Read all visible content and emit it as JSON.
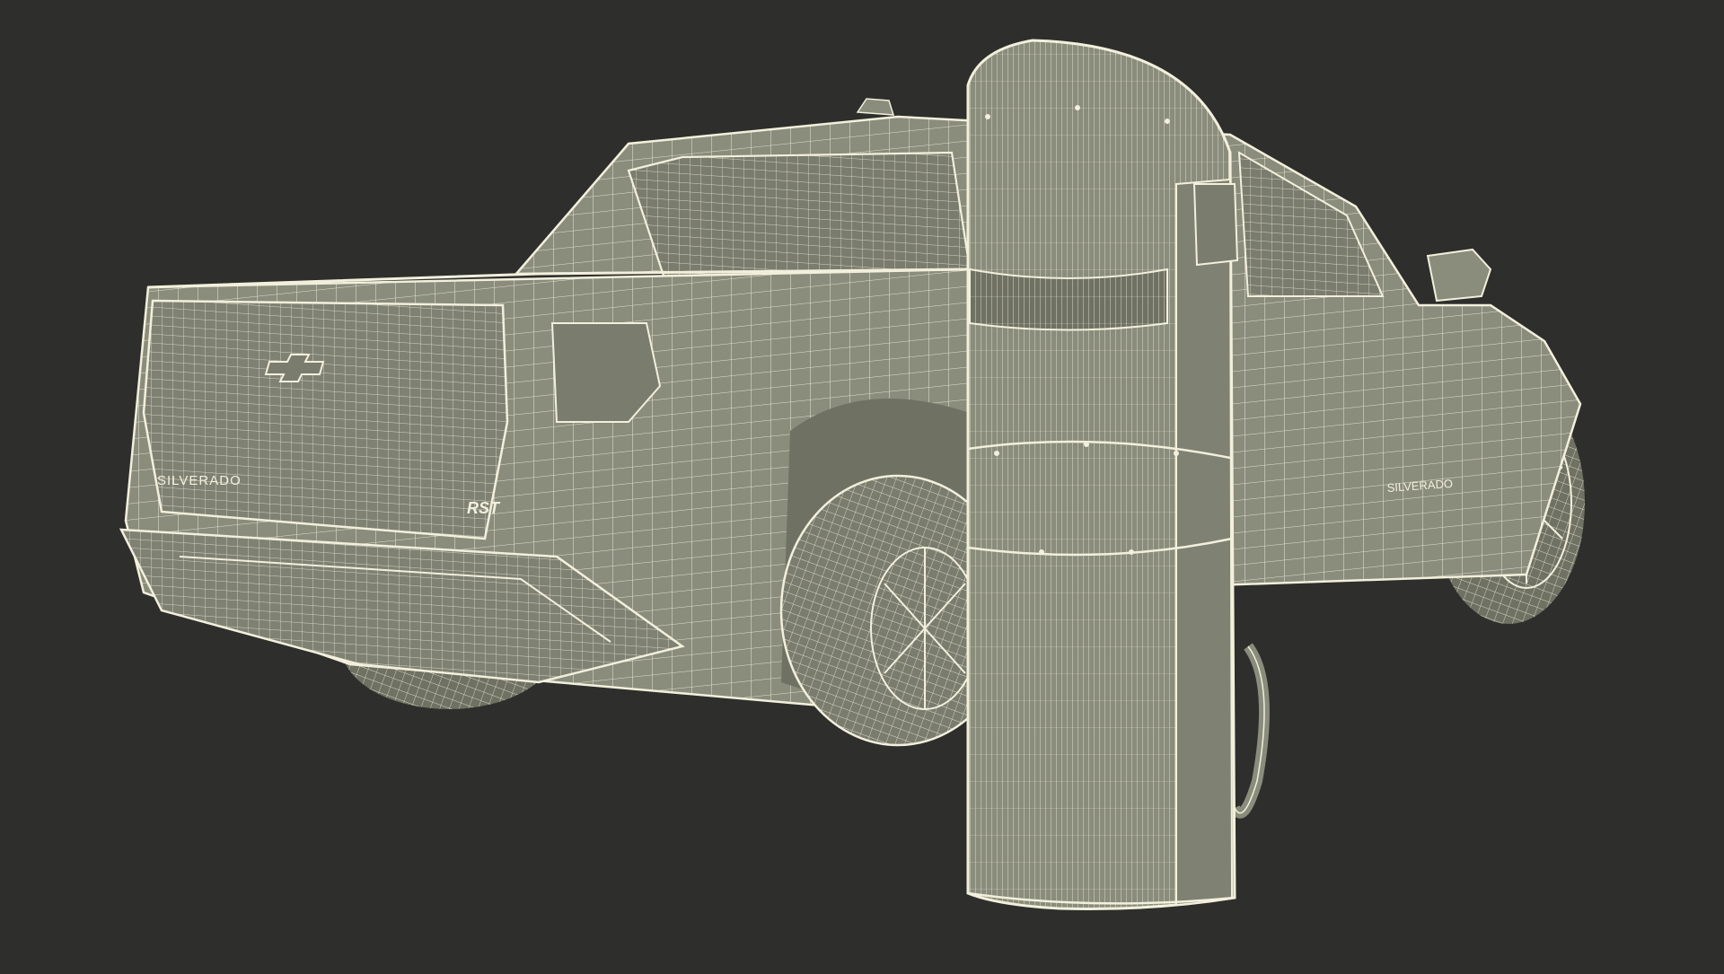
{
  "scene": {
    "background_color": "#2e2e2c",
    "surface_color": "#8a8c7c",
    "surface_dark": "#6f7163",
    "wire_color": "#f2f0dc",
    "shadow_color": "#5c5e52"
  },
  "truck": {
    "tailgate_badge": "SILVERADO",
    "trim_badge": "RST",
    "side_badge": "SILVERADO",
    "brand_logo": "bowtie-logo"
  },
  "charger": {
    "icon": "ev-charger-icon"
  }
}
